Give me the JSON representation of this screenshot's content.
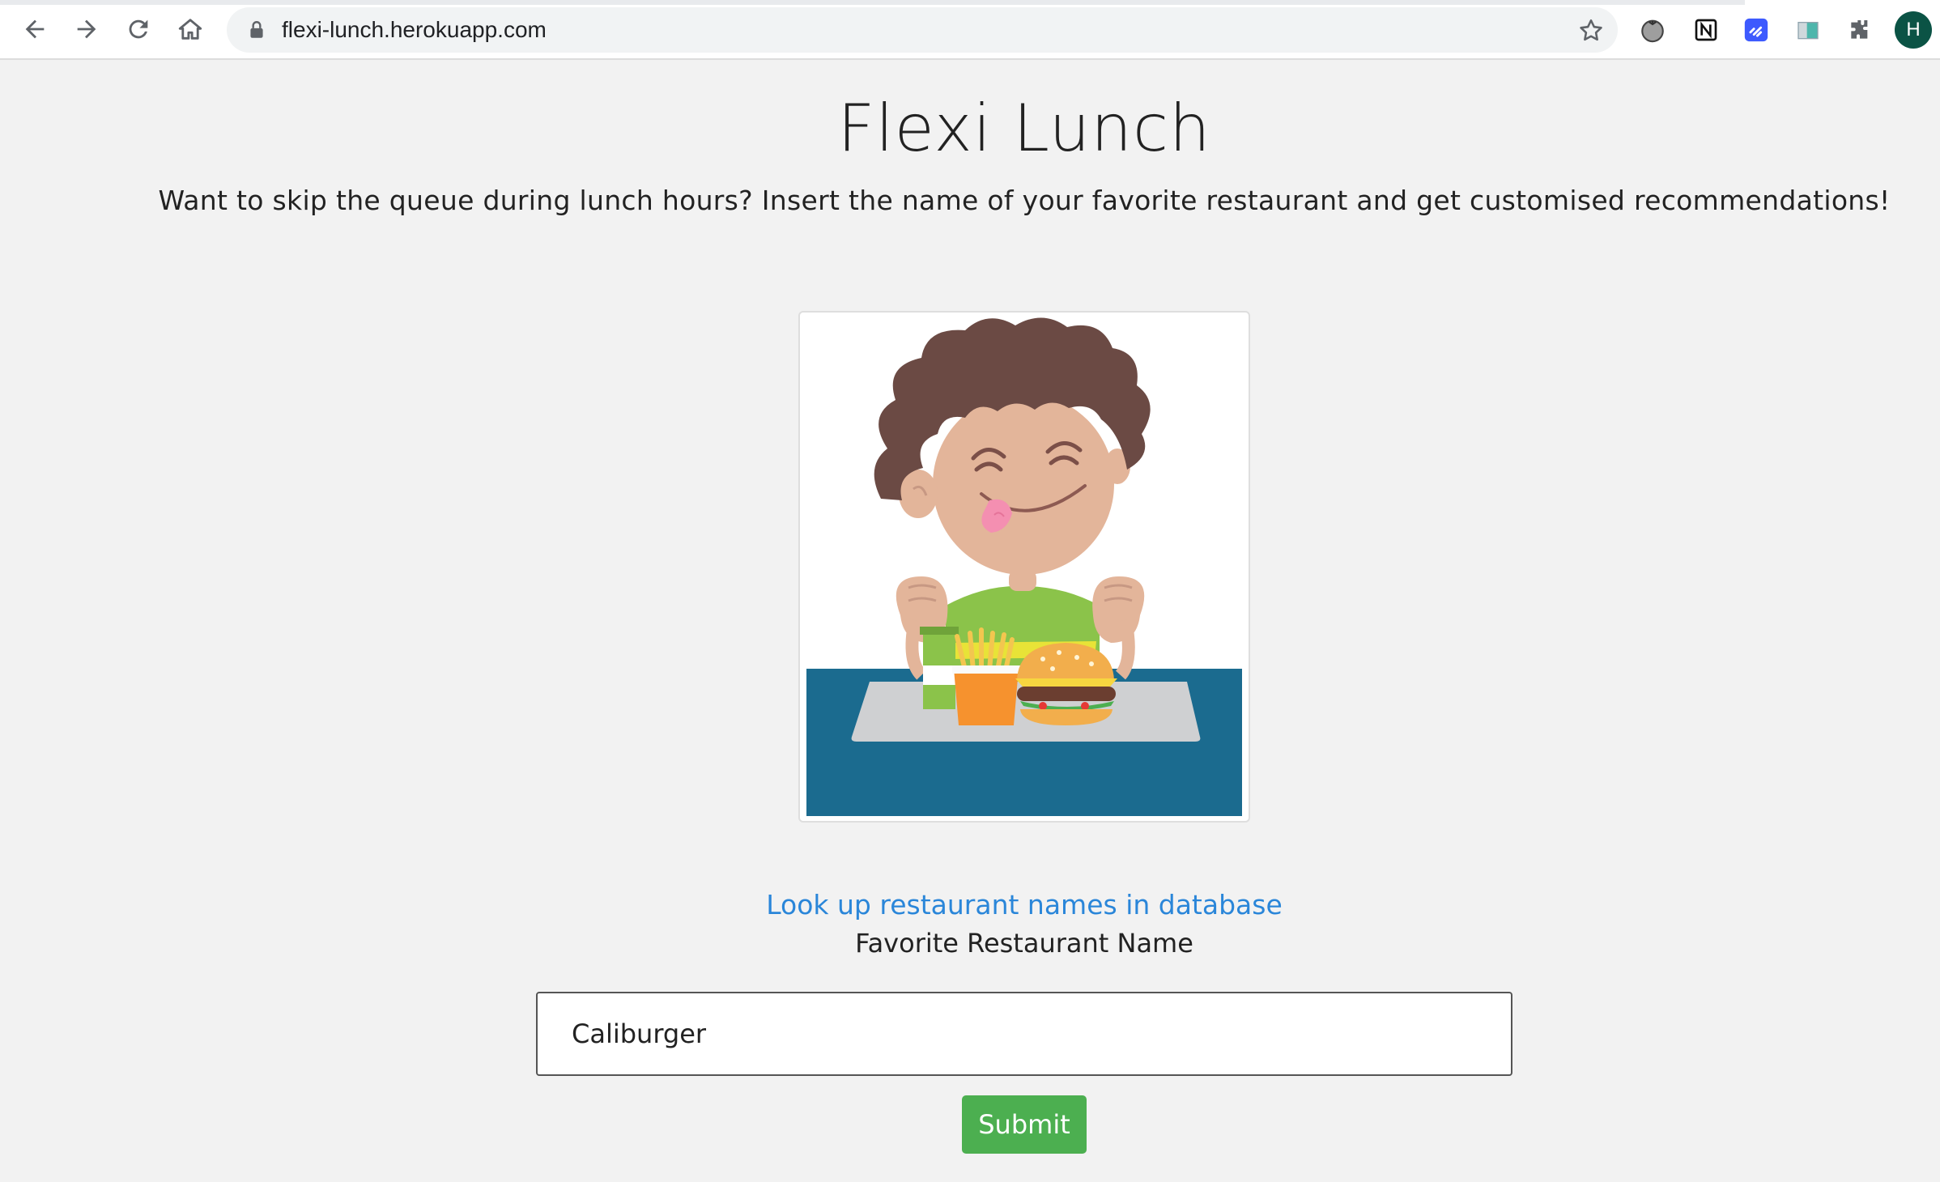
{
  "browser": {
    "url": "flexi-lunch.herokuapp.com",
    "profile_initial": "H",
    "extensions": [
      "tomato-timer-icon",
      "notion-icon",
      "link-extension-icon",
      "screen-extension-icon",
      "puzzle-icon"
    ]
  },
  "page": {
    "title": "Flexi Lunch",
    "subtitle": "Want to skip the queue during lunch hours? Insert the name of your favorite restaurant and get customised recommendations!",
    "image_alt": "cartoon-boy-eating-burger",
    "lookup_link": "Look up restaurant names in database",
    "field_label": "Favorite Restaurant Name",
    "input_value": "Caliburger",
    "submit_label": "Submit"
  },
  "colors": {
    "link": "#2a86d9",
    "submit": "#4caf50",
    "background": "#f2f2f2"
  }
}
